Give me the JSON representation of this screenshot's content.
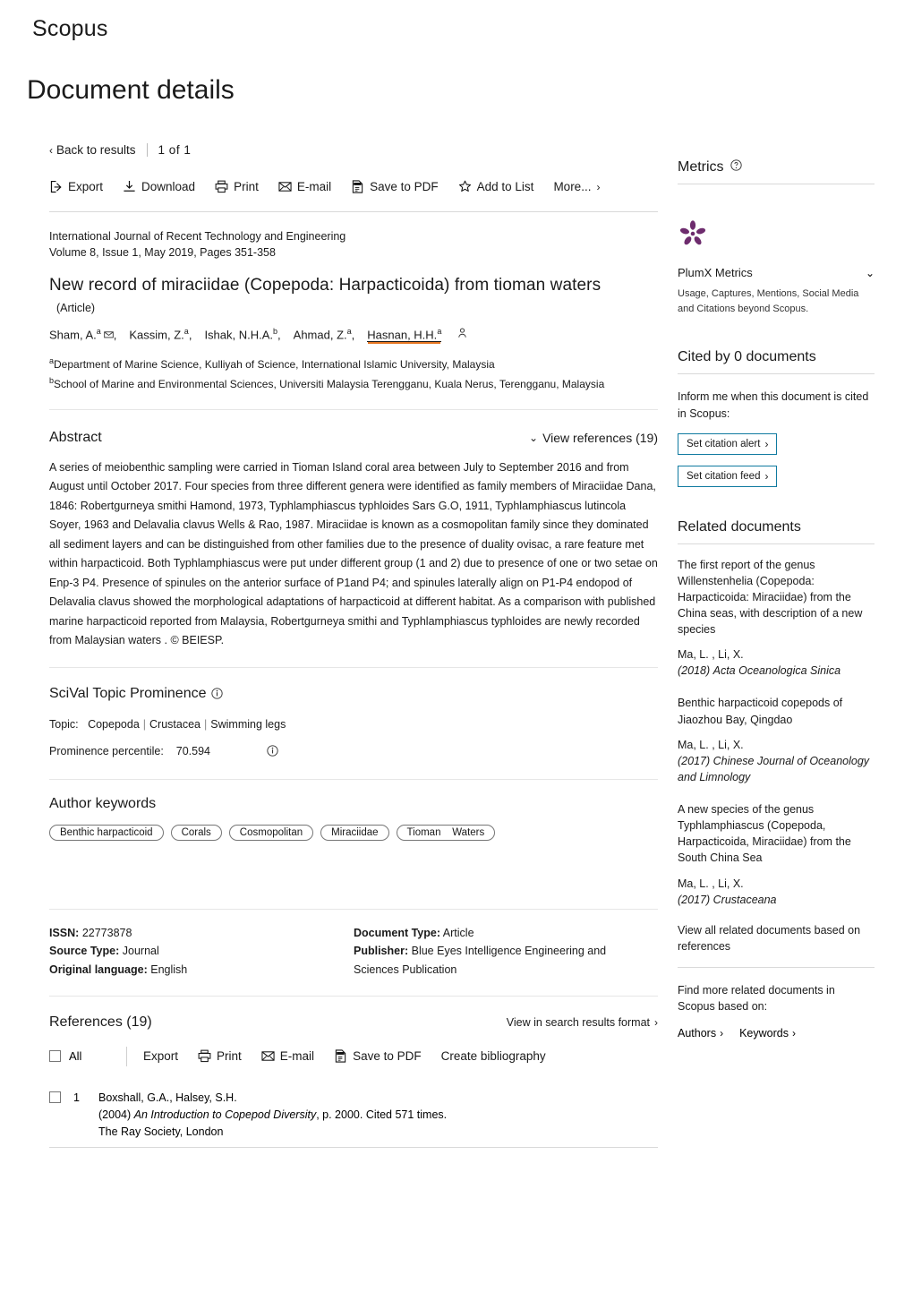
{
  "brand": "Scopus",
  "page_title": "Document details",
  "nav": {
    "back_label": "Back to results",
    "pager": "1  of  1"
  },
  "toolbar": [
    {
      "label": "Export",
      "icon": "export-icon"
    },
    {
      "label": "Download",
      "icon": "download-icon"
    },
    {
      "label": "Print",
      "icon": "printer-icon"
    },
    {
      "label": "E-mail",
      "icon": "envelope-icon"
    },
    {
      "label": "Save to PDF",
      "icon": "pdf-icon"
    },
    {
      "label": "Add to List",
      "icon": "star-icon"
    },
    {
      "label": "More...",
      "icon": "chevron-right-icon"
    }
  ],
  "source": {
    "journal": "International Journal of Recent Technology and Engineering",
    "issue": "Volume 8, Issue 1, May 2019, Pages 351-358"
  },
  "document": {
    "title": "New   record  of  miraciidae  (Copepoda: Harpacticoida) from  tioman   waters",
    "type_label": "(Article)",
    "authors": [
      {
        "name": "Sham, A.",
        "sup": "a",
        "has_mail": true,
        "highlighted": false
      },
      {
        "name": "Kassim, Z.",
        "sup": "a",
        "has_mail": false,
        "highlighted": false
      },
      {
        "name": "Ishak, N.H.A.",
        "sup": "b",
        "has_mail": false,
        "highlighted": false
      },
      {
        "name": "Ahmad, Z.",
        "sup": "a",
        "has_mail": false,
        "highlighted": false
      },
      {
        "name": "Hasnan, H.H.",
        "sup": "a",
        "has_mail": false,
        "highlighted": true
      }
    ],
    "affiliations": [
      {
        "sup": "a",
        "text": "Department of Marine Science, Kulliyah of Science, International Islamic University, Malaysia"
      },
      {
        "sup": "b",
        "text": "School of Marine and Environmental Sciences, Universiti Malaysia Terengganu, Kuala Nerus, Terengganu, Malaysia"
      }
    ]
  },
  "abstract": {
    "heading": "Abstract",
    "view_references": "View references (19)",
    "text": "A series of meiobenthic sampling were carried in  Tioman   Island coral area between July to September 2016 and from August until October 2017. Four species from three different genera were identified as family members of  Miraciidae   Dana, 1846: Robertgurneya smithi Hamond, 1973, Typhlamphiascus typhloides Sars G.O, 1911, Typhlamphiascus lutincola Soyer, 1963 and Delavalia clavus Wells & Rao, 1987.  Miraciidae   is known as a cosmopolitan family since they dominated all sediment layers and can be distinguished from other families due to the presence of duality ovisac, a rare feature met within harpacticoid. Both Typhlamphiascus were put under different group (1 and 2) due to presence of one or two setae on Enp-3 P4. Presence of spinules on the anterior surface of P1and P4; and spinules laterally align on P1-P4 endopod of Delavalia clavus showed the morphological adaptations of harpacticoid at different habitat. As a comparison with published marine harpacticoid reported from Malaysia, Robertgurneya smithi and Typhlamphiascus typhloides are newly recorded from Malaysian  waters . © BEIESP."
  },
  "scival": {
    "heading": "SciVal Topic Prominence",
    "topic_label": "Topic:",
    "topics": [
      "Copepoda",
      "Crustacea",
      "Swimming legs"
    ],
    "percentile_label": "Prominence percentile:",
    "percentile_value": "70.594"
  },
  "keywords": {
    "heading": "Author keywords",
    "items": [
      "Benthic harpacticoid",
      "Corals",
      "Cosmopolitan",
      "Miraciidae",
      "Tioman    Waters"
    ]
  },
  "meta": {
    "left": [
      {
        "label": "ISSN:",
        "value": "22773878"
      },
      {
        "label": "Source Type:",
        "value": "Journal"
      },
      {
        "label": "Original language:",
        "value": "English"
      }
    ],
    "right": [
      {
        "label": "Document Type:",
        "value": "Article"
      },
      {
        "label": "Publisher:",
        "value": "Blue Eyes Intelligence Engineering and Sciences Publication"
      }
    ]
  },
  "references": {
    "heading": "References (19)",
    "view_in_search": "View in search results format",
    "select_all_label": "All",
    "actions": [
      {
        "label": "Export",
        "icon": ""
      },
      {
        "label": "Print",
        "icon": "printer-icon"
      },
      {
        "label": "E-mail",
        "icon": "envelope-icon"
      },
      {
        "label": "Save to PDF",
        "icon": "pdf-icon"
      },
      {
        "label": "Create bibliography",
        "icon": ""
      }
    ],
    "items": [
      {
        "num": "1",
        "authors": "Boxshall, G.A., Halsey, S.H.",
        "year": "(2004)",
        "title": "An Introduction to Copepod Diversity",
        "tail": ", p. 2000. Cited 571 times.",
        "publisher": "The Ray Society, London"
      }
    ]
  },
  "sidebar": {
    "metrics": {
      "heading": "Metrics",
      "plumx_title": "PlumX Metrics",
      "plumx_desc": "Usage, Captures, Mentions, Social Media and Citations beyond Scopus.",
      "plumx_color": "#6E2C6E"
    },
    "cited_by": {
      "heading": "Cited by 0 documents",
      "inform_text": "Inform me when this document is cited in Scopus:",
      "buttons": [
        "Set citation alert",
        "Set citation feed"
      ],
      "button_border": "#0f7aa0"
    },
    "related": {
      "heading": "Related documents",
      "items": [
        {
          "title": "The first report of the genus Willenstenhelia (Copepoda: Harpacticoida: Miraciidae) from the China seas, with description of a new species",
          "authors": "Ma, L. , Li, X.",
          "year": "(2018)",
          "source": "Acta Oceanologica Sinica"
        },
        {
          "title": "Benthic harpacticoid copepods of Jiaozhou Bay, Qingdao",
          "authors": "Ma, L. , Li, X.",
          "year": "(2017)",
          "source": "Chinese Journal of Oceanology and Limnology"
        },
        {
          "title": "A new species of the genus Typhlamphiascus (Copepoda, Harpacticoida, Miraciidae) from the South China Sea",
          "authors": "Ma, L. , Li, X.",
          "year": "(2017)",
          "source": "Crustaceana"
        }
      ],
      "view_all": "View all related documents based on references",
      "find_more": "Find more related documents in Scopus based on:",
      "find_links": [
        "Authors",
        "Keywords"
      ]
    }
  }
}
